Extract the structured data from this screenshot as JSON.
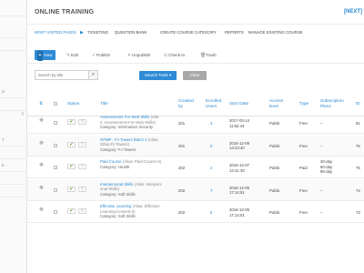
{
  "app": {
    "title": "ONLINE TRAINING",
    "next_link": "[NEXT]"
  },
  "sidebar": {
    "items": [
      {
        "label": ""
      },
      {
        "label": ""
      },
      {
        "label": ""
      },
      {
        "label": "G"
      },
      {
        "label": ""
      },
      {
        "label": "T"
      },
      {
        "label": ""
      },
      {
        "label": "E"
      },
      {
        "label": "TE"
      },
      {
        "label": ""
      },
      {
        "label": ""
      }
    ]
  },
  "nav": {
    "active": "MOST VISITED PAGES",
    "arrow": "▶",
    "items": [
      "TICKETING",
      "QUESTION BANK",
      "CREATE COURSE CATEGORY",
      "REPORTS",
      "MANAGE EXISTING COURSE"
    ]
  },
  "toolbar": {
    "new": "New",
    "edit": "Edit",
    "publish": "Publish",
    "unpublish": "Unpublish",
    "checkin": "Check-in",
    "trash": "Trash"
  },
  "icons": {
    "new": "plus-icon",
    "edit": "edit-icon",
    "publish": "check-icon",
    "unpublish": "cross-icon",
    "checkin": "check-in-icon",
    "trash": "trash-icon",
    "search": "search-icon",
    "drag": "drag-handle-icon",
    "sort": "sort-icon",
    "collapse": "chevron-left-icon",
    "published": "check-icon",
    "featured": "star-icon"
  },
  "search": {
    "placeholder": "Search by title",
    "value": "",
    "tools_label": "Search Tools ▾",
    "clear_label": "Clear"
  },
  "table": {
    "headers": {
      "sort": "⇅",
      "select": "",
      "status": "Status",
      "title": "Title",
      "created_by": [
        "Created",
        "by"
      ],
      "enrolled": [
        "Enrolled",
        "Users"
      ],
      "start_date": "Start Date",
      "access": [
        "Access",
        "level"
      ],
      "type": "Type",
      "plans": [
        "Subscription",
        "Plans"
      ],
      "id": "ID"
    },
    "rows": [
      {
        "title": "Assessments For Web Skills",
        "alias_lines": [
          "(Alia",
          "s: Assessments-For-Web-Skills)"
        ],
        "title_suffix": "",
        "category": "Category: Information Security",
        "created_by": "201",
        "enrolled": "3",
        "date": "2017-03-14",
        "time": "11:52:44",
        "access": "Public",
        "type": "Free",
        "plans": [
          "--"
        ],
        "id": "81"
      },
      {
        "title": "GFMP - FJ Towers Batch 1",
        "alias_lines": [
          "(Alias:",
          "Gfmp-Fj-Towers)"
        ],
        "title_suffix": "",
        "category": "Category: FJ Towers",
        "created_by": "201",
        "enrolled": "0",
        "date": "2016-12-09",
        "time": "13:23:40",
        "access": "Public",
        "type": "Free",
        "plans": [
          "--"
        ],
        "id": "76"
      },
      {
        "title": "Paid Course",
        "alias_lines": [
          "(Alias: Paid-Course-3)"
        ],
        "title_suffix": "",
        "category": "Category: Health",
        "created_by": "202",
        "enrolled": "2",
        "date": "2016-12-07",
        "time": "12:41:30",
        "access": "Public",
        "type": "Paid",
        "plans": [
          "30-day",
          "60-day",
          "90-day"
        ],
        "id": "75"
      },
      {
        "title": "Interpersonal Skills",
        "alias_lines": [
          "(Alias: Interpers",
          "onal-Skills)"
        ],
        "title_suffix": "",
        "category": "Category: Soft Skills",
        "created_by": "202",
        "enrolled": "7",
        "date": "2016-12-05",
        "time": "17:14:51",
        "access": "Public",
        "type": "Free",
        "plans": [
          "--"
        ],
        "id": "74"
      },
      {
        "title": "Effective Learning",
        "alias_lines": [
          "(Alias: Effective-",
          "Learning-Content-2)"
        ],
        "title_suffix": "",
        "category": "Category: Soft Skills",
        "created_by": "202",
        "enrolled": "6",
        "date": "2016-12-05",
        "time": "17:14:01",
        "access": "Public",
        "type": "Free",
        "plans": [
          "--"
        ],
        "id": "73"
      }
    ]
  },
  "colors": {
    "accent": "#2e8bd6",
    "link": "#2b8ad2",
    "check": "#5aa02c",
    "clear": "#a8a8a8"
  }
}
